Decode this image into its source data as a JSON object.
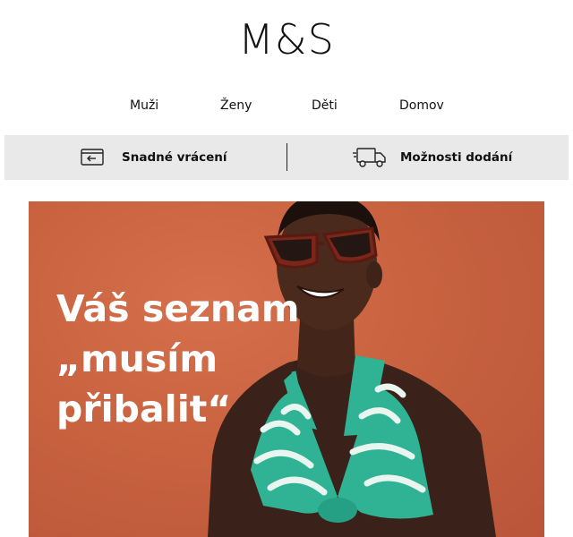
{
  "brand": {
    "logo_text": "M&S"
  },
  "nav": {
    "items": [
      {
        "label": "Muži"
      },
      {
        "label": "Ženy"
      },
      {
        "label": "Děti"
      },
      {
        "label": "Domov"
      }
    ]
  },
  "services": {
    "returns": {
      "label": "Snadné vrácení",
      "icon": "card-return-icon"
    },
    "delivery": {
      "label": "Možnosti dodání",
      "icon": "delivery-truck-icon"
    }
  },
  "hero": {
    "headline_lines": [
      "Váš seznam",
      "„musím",
      "přibalit“"
    ],
    "colors": {
      "background": "#c8623f",
      "text": "#ffffff",
      "swimsuit": "#2fb394"
    }
  }
}
